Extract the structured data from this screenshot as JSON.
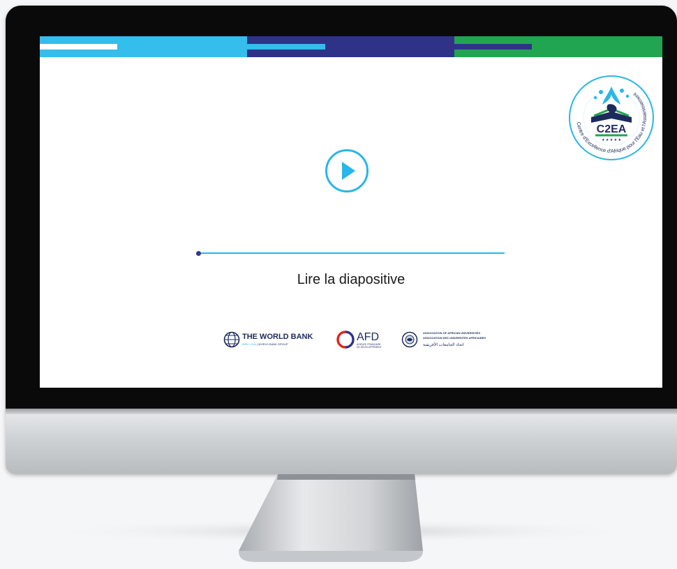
{
  "colors": {
    "stripe_light_blue": "#35bdec",
    "stripe_navy": "#2f3388",
    "stripe_green": "#21a550",
    "accent_blue": "#29b6e8",
    "navy": "#1d2b5c"
  },
  "header_stripes": [
    {
      "color": "#35bdec",
      "inner_color": "#ffffff"
    },
    {
      "color": "#2f3388",
      "inner_color": "#35bdec"
    },
    {
      "color": "#21a550",
      "inner_color": "#2f3388"
    }
  ],
  "logo": {
    "brand": "C2EA",
    "ring_text": "Centre d'Excellence d'Afrique pour l'Eau et l'Assainissement",
    "stars": "★ ★ ★ ★ ★"
  },
  "player": {
    "play_icon": "play-icon",
    "progress_percent": 0,
    "label": "Lire la diapositive"
  },
  "partners": {
    "world_bank": {
      "name": "THE WORLD BANK",
      "sub_ibrd": "IBRD • IDA",
      "sub_group": "| WORLD BANK GROUP"
    },
    "afd": {
      "name": "AFD",
      "sub_line1": "AGENCE FRANÇAISE",
      "sub_line2": "DE DÉVELOPPEMENT"
    },
    "aau": {
      "line1": "ASSOCIATION OF AFRICAN UNIVERSITIES",
      "line2": "ASSOCIATION DES UNIVERSITES AFRICAINES",
      "arabic": "اتحاد الجامعات الأفريقية"
    }
  }
}
